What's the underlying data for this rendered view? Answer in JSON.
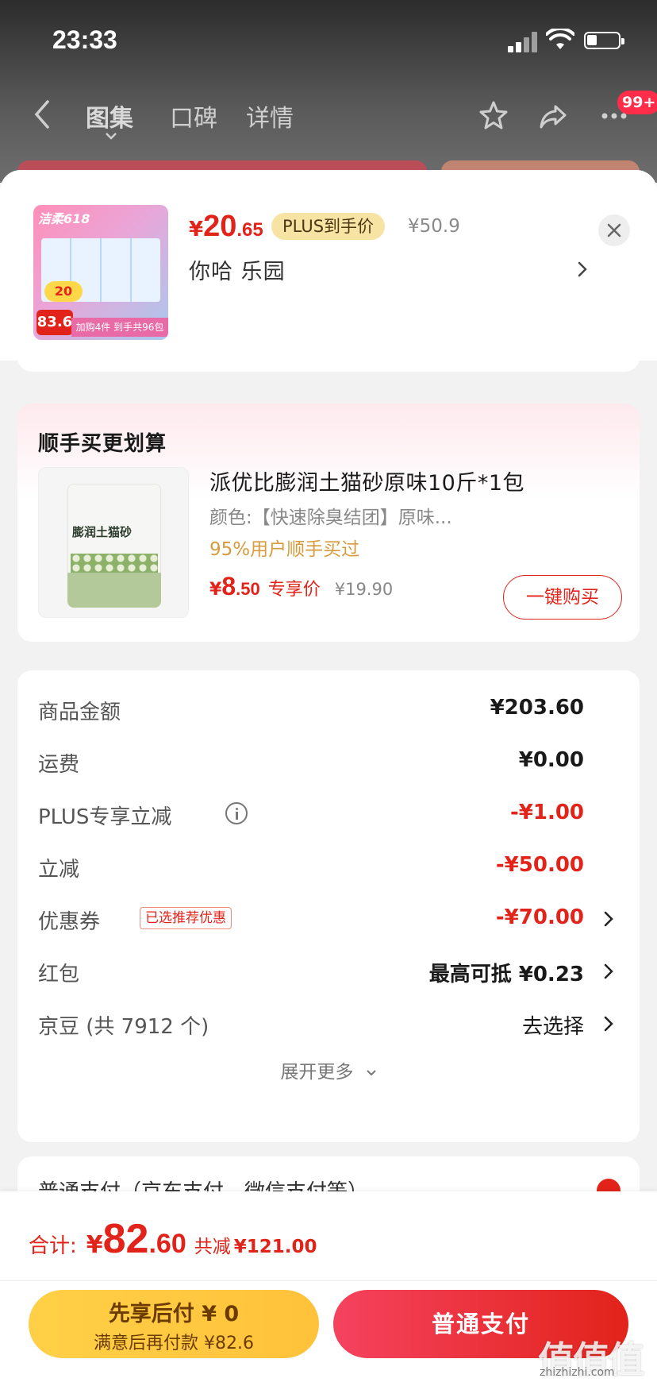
{
  "status": {
    "time": "23:33"
  },
  "nav": {
    "tabs": [
      {
        "label": "图集",
        "active": true
      },
      {
        "label": "口碑",
        "active": false
      },
      {
        "label": "详情",
        "active": false
      }
    ],
    "badge": "99+",
    "icons": [
      "back-icon",
      "star-icon",
      "share-icon",
      "more-icon"
    ]
  },
  "product": {
    "thumb_brand": "洁柔618",
    "thumb_tag": "20",
    "thumb_price": "83.6",
    "thumb_strip": "加购4件 到手共96包",
    "price_currency": "¥",
    "price_int": "20",
    "price_dec": ".65",
    "plus_tag": "PLUS到手价",
    "original_price": "¥50.9",
    "variant": "你哈  乐园"
  },
  "addon": {
    "title": "顺手买更划算",
    "name": "派优比膨润土猫砂原味10斤*1包",
    "spec": "颜色:【快速除臭结团】原味...",
    "rate": "95%用户顺手买过",
    "price_currency": "¥",
    "price_int": "8",
    "price_dec": ".50",
    "price_label": "专享价",
    "original_price": "¥19.90",
    "buy_label": "一键购买",
    "bag_label": "膨润土猫砂"
  },
  "summary": {
    "rows": [
      {
        "key": "商品金额",
        "value": "¥203.60"
      },
      {
        "key": "运费",
        "value": "¥0.00"
      },
      {
        "key": "PLUS专享立减",
        "value": "-¥1.00"
      },
      {
        "key": "立减",
        "value": "-¥50.00"
      },
      {
        "key": "优惠券",
        "value": "-¥70.00",
        "tag": "已选推荐优惠"
      },
      {
        "key": "红包",
        "value": "最高可抵 ¥0.23"
      },
      {
        "key": "京豆 (共 7912 个)",
        "value": "去选择"
      }
    ],
    "expand_label": "展开更多"
  },
  "payment": {
    "partial_text": "普通支付（京东支付、微信支付等）"
  },
  "footer": {
    "total_label": "合计:",
    "total_currency": "¥",
    "total_int": "82",
    "total_dec": ".60",
    "saved_label": "共减",
    "saved_value": "¥121.00",
    "later_title": "先享后付 ¥ 0",
    "later_sub": "满意后再付款 ¥82.6",
    "pay_label": "普通支付",
    "watermark": "值值值",
    "watermark_sub": "zhizhizhi.com"
  },
  "colors": {
    "accent": "#e2231a",
    "plus": "#f7e3a3",
    "later": "#ffc23a"
  }
}
